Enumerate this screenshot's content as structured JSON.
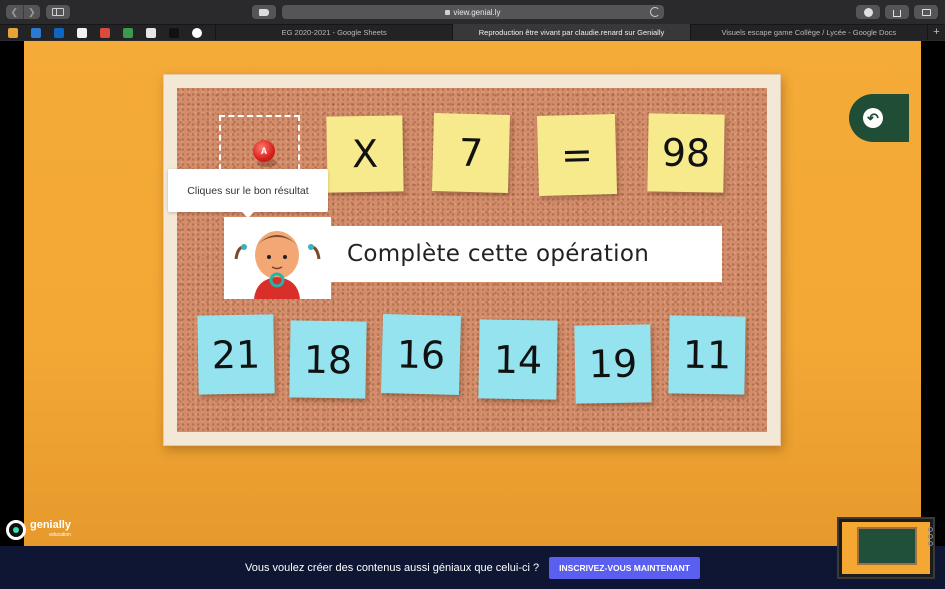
{
  "browser": {
    "url": "view.genial.ly",
    "tabs": [
      {
        "label": "EG 2020-2021 - Google Sheets",
        "active": false
      },
      {
        "label": "Reproduction être vivant par claudie.renard sur Genially",
        "active": true
      },
      {
        "label": "Visuels escape game Collège / Lycée - Google Docs",
        "active": false
      }
    ],
    "new_tab_label": "+",
    "favicons": [
      "bookmark-icon",
      "twitter-icon",
      "outlook-icon",
      "mk-icon",
      "gmail-icon",
      "drive-icon",
      "docs-icon",
      "black-icon",
      "google-icon"
    ]
  },
  "puzzle": {
    "equation": {
      "operator": "X",
      "operand": "7",
      "equals": "=",
      "result": "98"
    },
    "pin_label": "A",
    "tooltip": "Cliques sur le bon résultat",
    "instruction": "Complète cette opération",
    "choices": [
      "21",
      "18",
      "16",
      "14",
      "19",
      "11"
    ]
  },
  "branding": {
    "name": "genially",
    "sub": "education"
  },
  "banner": {
    "text": "Vous voulez créer des contenus aussi géniaux que celui-ci ?",
    "button": "INSCRIVEZ-VOUS MAINTENANT"
  },
  "colors": {
    "background": "#f7b03d",
    "sticky_yellow": "#f6ea8c",
    "sticky_blue": "#94e3ef",
    "banner": "#0e1633",
    "banner_button": "#5b5ff0",
    "back_button": "#1f4d35"
  }
}
